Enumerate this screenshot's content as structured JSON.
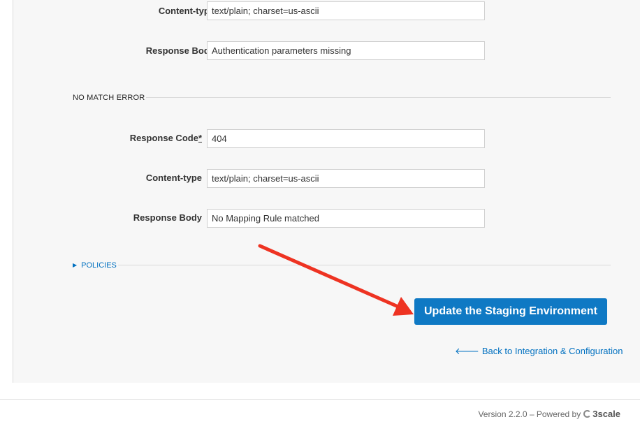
{
  "auth_error": {
    "content_type_label": "Content-type",
    "content_type_value": "text/plain; charset=us-ascii",
    "response_body_label": "Response Body",
    "response_body_value": "Authentication parameters missing"
  },
  "no_match_error": {
    "section_title": "NO MATCH ERROR",
    "response_code_label": "Response Code",
    "response_code_required": "*",
    "response_code_value": "404",
    "content_type_label": "Content-type",
    "content_type_value": "text/plain; charset=us-ascii",
    "response_body_label": "Response Body",
    "response_body_value": "No Mapping Rule matched"
  },
  "policies": {
    "label": "POLICIES",
    "caret_icon": "triangle-right-icon"
  },
  "actions": {
    "update_button": "Update the Staging Environment",
    "back_link": "Back to Integration & Configuration",
    "back_icon": "arrow-left-icon"
  },
  "annotation": {
    "arrow_color": "#ee3322"
  },
  "footer": {
    "version_text": "Version 2.2.0 – Powered by",
    "logo_text": "3scale"
  },
  "colors": {
    "primary_button": "#0f79c4",
    "link": "#0070c0"
  }
}
